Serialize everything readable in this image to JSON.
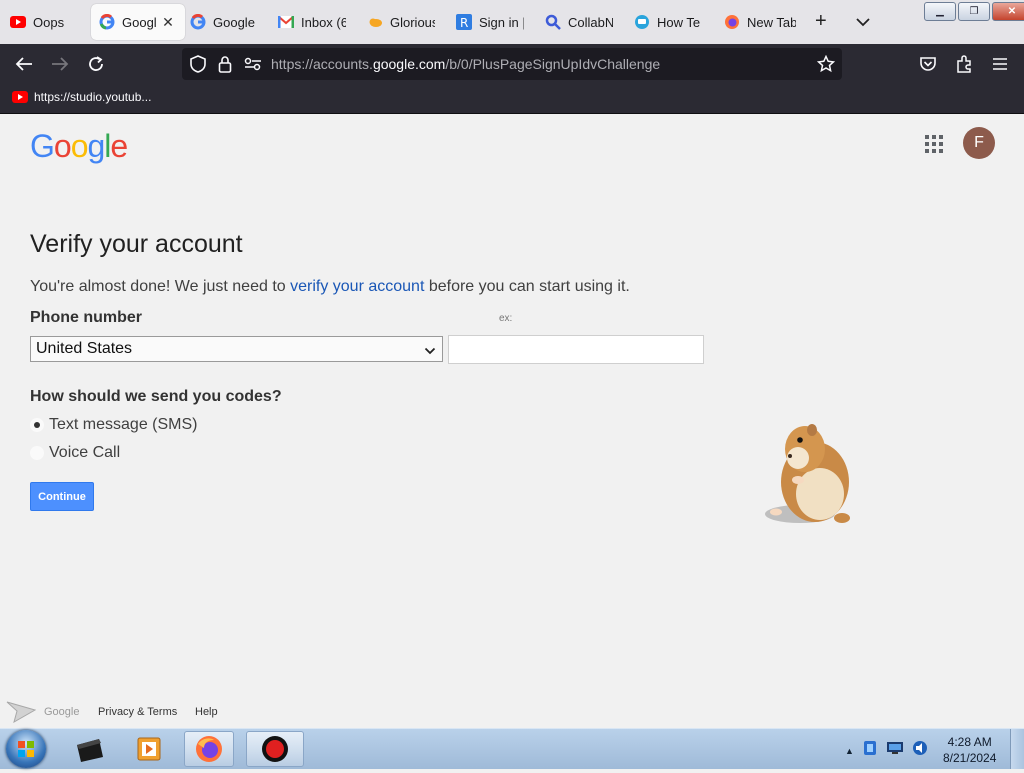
{
  "browser": {
    "tabs": [
      {
        "title": "Oops",
        "icon": "youtube-icon"
      },
      {
        "title": "Googl",
        "icon": "google-icon",
        "active": true
      },
      {
        "title": "Google A",
        "icon": "google-icon"
      },
      {
        "title": "Inbox (6",
        "icon": "gmail-icon"
      },
      {
        "title": "Glorious",
        "icon": "cloud-icon"
      },
      {
        "title": "Sign in |",
        "icon": "r-icon"
      },
      {
        "title": "CollabN",
        "icon": "magnifier-icon"
      },
      {
        "title": "How Te",
        "icon": "chat-icon"
      },
      {
        "title": "New Tab",
        "icon": "firefox-icon"
      }
    ],
    "url_prefix": "https://accounts.",
    "url_domain": "google.com",
    "url_path": "/b/0/PlusPageSignUpIdvChallenge",
    "bookmark": "https://studio.youtub..."
  },
  "page": {
    "logo": [
      "G",
      "o",
      "o",
      "g",
      "l",
      "e"
    ],
    "avatar_letter": "F",
    "title": "Verify your account",
    "intro_before": "You're almost done! We just need to ",
    "intro_link": "verify your account",
    "intro_after": " before you can start using it.",
    "phone_label": "Phone number",
    "phone_example": "ex:",
    "country": "United States",
    "phone_value": "",
    "codes_label": "How should we send you codes?",
    "options": [
      {
        "label": "Text message (SMS)",
        "selected": true
      },
      {
        "label": "Voice Call",
        "selected": false
      }
    ],
    "continue": "Continue",
    "footer": {
      "google": "Google",
      "privacy": "Privacy & Terms",
      "help": "Help"
    }
  },
  "taskbar": {
    "time": "4:28 AM",
    "date": "8/21/2024"
  },
  "colors": {
    "link": "#1a57b6",
    "continue_button": "#4d90fe",
    "browser_toolbar": "#2b2a33"
  }
}
